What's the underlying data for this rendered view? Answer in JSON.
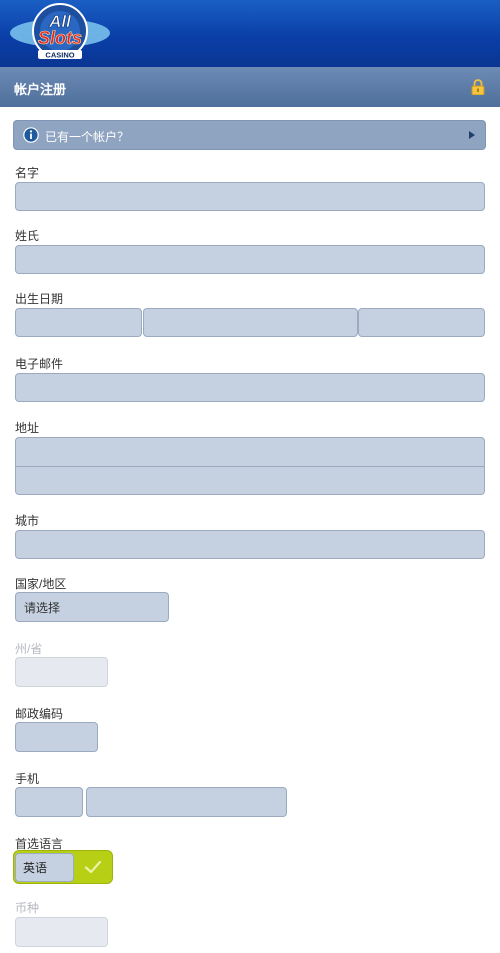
{
  "logo": {
    "primary": "All",
    "secondary": "Slots",
    "tertiary": "CASINO"
  },
  "header": {
    "title": "帐户注册",
    "lock_icon": "lock-icon"
  },
  "info_bar": {
    "text": "已有一个帐户？",
    "icon": "info-icon",
    "arrow_icon": "triangle-right-icon"
  },
  "form": {
    "first_name": {
      "label": "名字",
      "value": ""
    },
    "last_name": {
      "label": "姓氏",
      "value": ""
    },
    "dob": {
      "label": "出生日期",
      "day": "",
      "month": "",
      "year": ""
    },
    "email": {
      "label": "电子邮件",
      "value": ""
    },
    "address": {
      "label": "地址",
      "line1": "",
      "line2": ""
    },
    "city": {
      "label": "城市",
      "value": ""
    },
    "country": {
      "label": "国家/地区",
      "value": "请选择"
    },
    "state": {
      "label": "州/省",
      "value": ""
    },
    "postal": {
      "label": "邮政编码",
      "value": ""
    },
    "mobile": {
      "label": "手机",
      "code": "",
      "number": ""
    },
    "language": {
      "label": "首选语言",
      "value": "英语",
      "check_icon": "checkmark-icon"
    },
    "currency": {
      "label": "币种",
      "value": ""
    }
  },
  "colors": {
    "accent": "#b7cf15",
    "header": "#5a79a6",
    "topbar": "#0a3fa8",
    "field": "#c5d1e0"
  }
}
